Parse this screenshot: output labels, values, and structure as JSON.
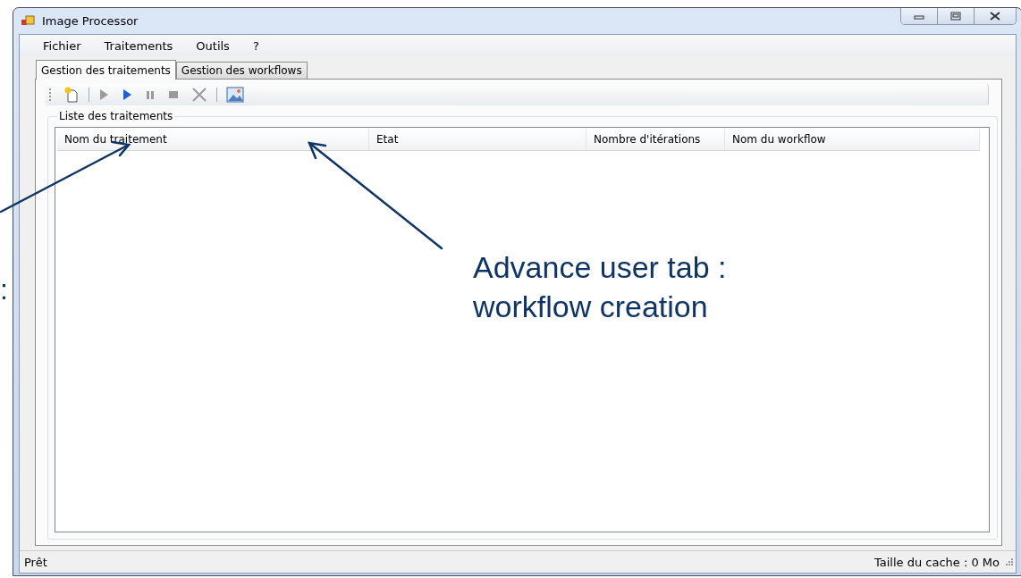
{
  "window": {
    "title": "Image Processor"
  },
  "menu": [
    "Fichier",
    "Traitements",
    "Outils",
    "?"
  ],
  "tabs": [
    {
      "label": "Gestion des traitements",
      "selected": true
    },
    {
      "label": "Gestion des workflows",
      "selected": false
    }
  ],
  "toolbar": [
    {
      "kind": "new",
      "disabled": false
    },
    {
      "kind": "separator"
    },
    {
      "kind": "play",
      "disabled": true
    },
    {
      "kind": "play",
      "disabled": false
    },
    {
      "kind": "pause",
      "disabled": true
    },
    {
      "kind": "stop",
      "disabled": true
    },
    {
      "kind": "delete",
      "disabled": true
    },
    {
      "kind": "separator"
    },
    {
      "kind": "image",
      "disabled": false
    }
  ],
  "group": {
    "title": "Liste des traitements"
  },
  "table": {
    "columns": [
      "Nom du traitement",
      "Etat",
      "Nombre d'itérations",
      "Nom du workflow"
    ]
  },
  "status_bar": {
    "left": "Prêt",
    "right": "Taille du cache : 0 Mo"
  },
  "annotations": {
    "left_fragment": ":",
    "callout": [
      "Advance user tab :",
      "workflow creation"
    ]
  }
}
